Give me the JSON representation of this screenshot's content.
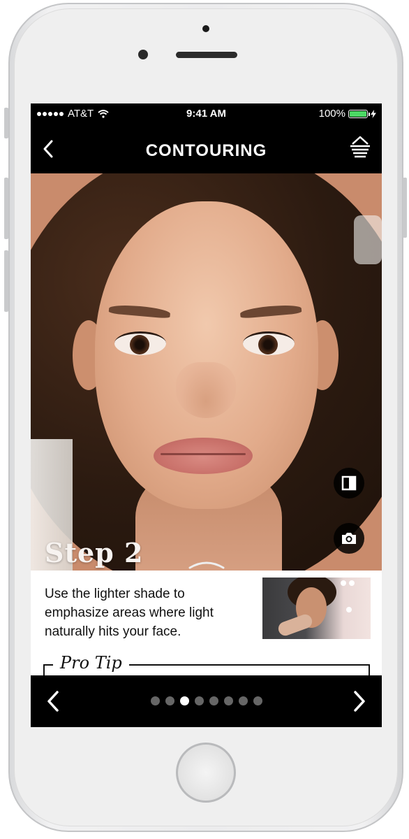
{
  "status_bar": {
    "carrier": "AT&T",
    "time": "9:41 AM",
    "battery_percent": "100%",
    "battery_level": 1.0,
    "battery_color": "#4cd964"
  },
  "nav": {
    "title": "CONTOURING",
    "back_icon": "chevron-left-icon",
    "menu_icon": "layers-menu-icon"
  },
  "hero": {
    "step_label": "Step 2",
    "compare_icon": "split-compare-icon",
    "camera_icon": "camera-icon",
    "handle_icon": "chevron-up-icon"
  },
  "panel": {
    "description": "Use the lighter shade to emphasize areas where light naturally hits your face.",
    "pro_tip_label": "Pro Tip"
  },
  "pager": {
    "total": 8,
    "active_index": 2,
    "prev_icon": "chevron-left-icon",
    "next_icon": "chevron-right-icon"
  }
}
